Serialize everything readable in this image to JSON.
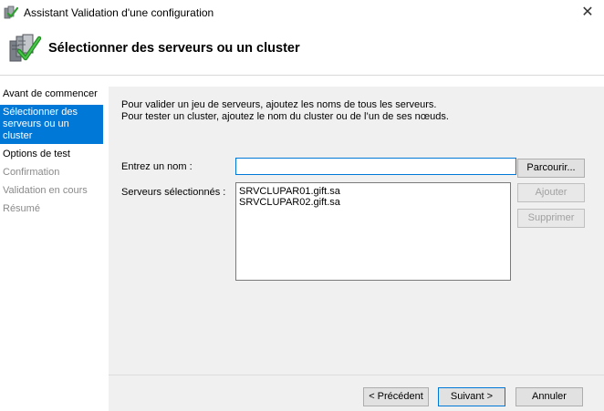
{
  "window": {
    "title": "Assistant Validation d'une configuration",
    "close_glyph": "✕",
    "app_icon": "validation-wizard-icon"
  },
  "header": {
    "title": "Sélectionner des serveurs ou un cluster",
    "icon": "server-checkmark-icon"
  },
  "sidebar": {
    "items": [
      {
        "label": "Avant de commencer",
        "state": "normal"
      },
      {
        "label": "Sélectionner des serveurs ou un cluster",
        "state": "active"
      },
      {
        "label": "Options de test",
        "state": "normal"
      },
      {
        "label": "Confirmation",
        "state": "disabled"
      },
      {
        "label": "Validation en cours",
        "state": "disabled"
      },
      {
        "label": "Résumé",
        "state": "disabled"
      }
    ]
  },
  "main": {
    "intro_line1": "Pour valider un jeu de serveurs, ajoutez les noms de tous les serveurs.",
    "intro_line2": "Pour tester un cluster, ajoutez le nom du cluster ou de l’un de ses nœuds.",
    "name_label": "Entrez un nom :",
    "name_value": "",
    "selected_label": "Serveurs sélectionnés :",
    "servers": [
      "SRVCLUPAR01.gift.sa",
      "SRVCLUPAR02.gift.sa"
    ],
    "browse_label": "Parcourir...",
    "add_label": "Ajouter",
    "remove_label": "Supprimer"
  },
  "footer": {
    "previous_label": "< Précédent",
    "next_label": "Suivant >",
    "cancel_label": "Annuler"
  },
  "colors": {
    "accent": "#0078d7",
    "content_bg": "#f0f0f0"
  }
}
